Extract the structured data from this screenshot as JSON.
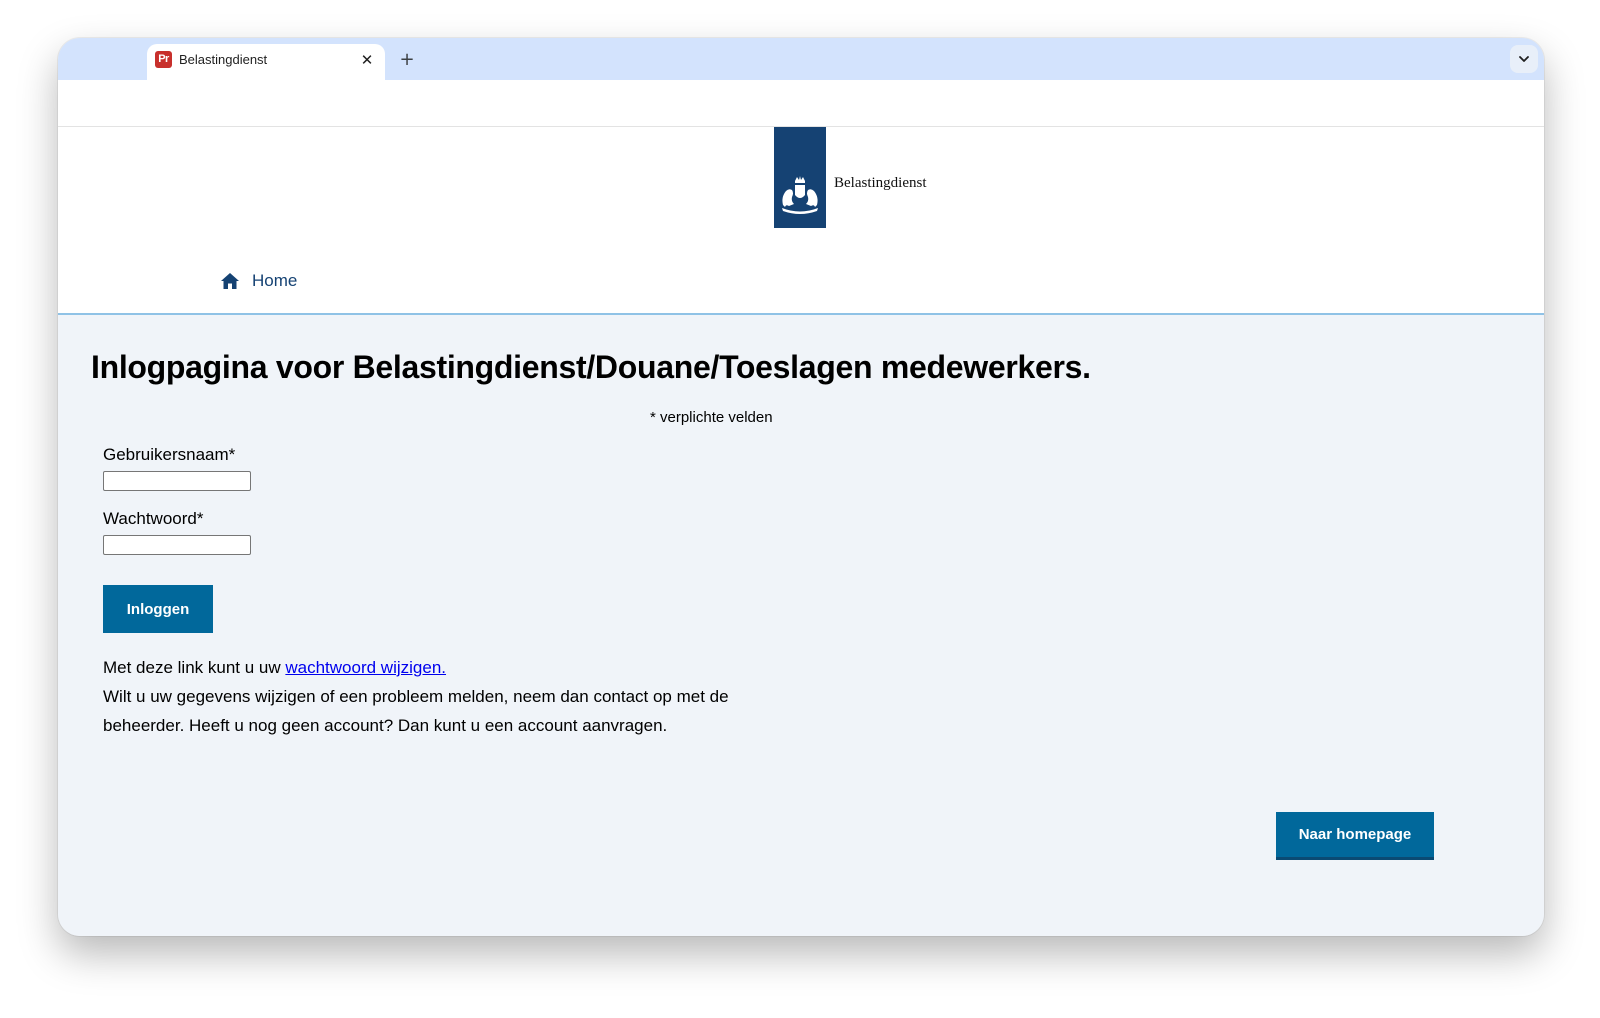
{
  "browser": {
    "tab": {
      "favicon_text": "Pr",
      "title": "Belastingdienst",
      "close_glyph": "✕"
    },
    "new_tab_glyph": "+",
    "icons": [
      "favicon-icon",
      "close-icon",
      "plus-icon",
      "chevron-down-icon"
    ]
  },
  "header": {
    "logo_text": "Belastingdienst",
    "nav": {
      "home_label": "Home"
    },
    "colors": {
      "logo_blue": "#154273",
      "divider": "#8fc2e6"
    }
  },
  "main": {
    "title": "Inlogpagina voor Belastingdienst/Douane/Toeslagen medewerkers.",
    "required_note": "* verplichte velden",
    "form": {
      "username_label": "Gebruikersnaam*",
      "username_value": "",
      "password_label": "Wachtwoord*",
      "password_value": "",
      "submit_label": "Inloggen"
    },
    "info": {
      "line1_prefix": "Met deze link kunt u uw ",
      "line1_link": "wachtwoord wijzigen.",
      "line2": "Wilt u uw gegevens wijzigen of een probleem melden, neem dan contact op met de beheerder. Heeft u nog geen account? Dan kunt u een account aanvragen."
    },
    "homepage_button_label": "Naar homepage",
    "colors": {
      "button": "#01689b",
      "link": "#0000ee",
      "background": "#f0f4f9"
    }
  }
}
